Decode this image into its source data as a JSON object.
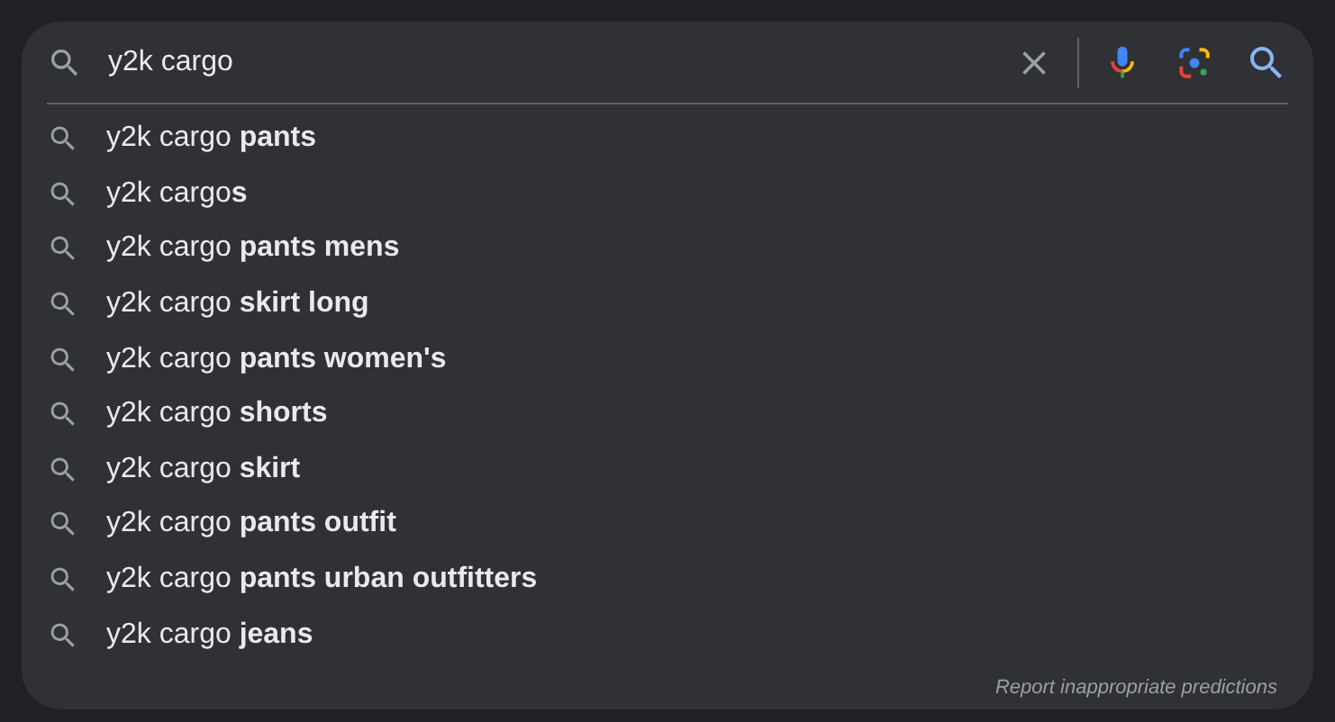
{
  "search": {
    "value": "y2k cargo"
  },
  "suggestions": [
    {
      "text": "y2k cargo **pants**"
    },
    {
      "text": "y2k cargo**s**"
    },
    {
      "text": "y2k cargo **pants mens**"
    },
    {
      "text": "y2k cargo **skirt long**"
    },
    {
      "text": "y2k cargo **pants women's**"
    },
    {
      "text": "y2k cargo **shorts**"
    },
    {
      "text": "y2k cargo **skirt**"
    },
    {
      "text": "y2k cargo **pants outfit**"
    },
    {
      "text": "y2k cargo **pants urban outfitters**"
    },
    {
      "text": "y2k cargo **jeans**"
    }
  ],
  "footer_link": "Report inappropriate predictions"
}
